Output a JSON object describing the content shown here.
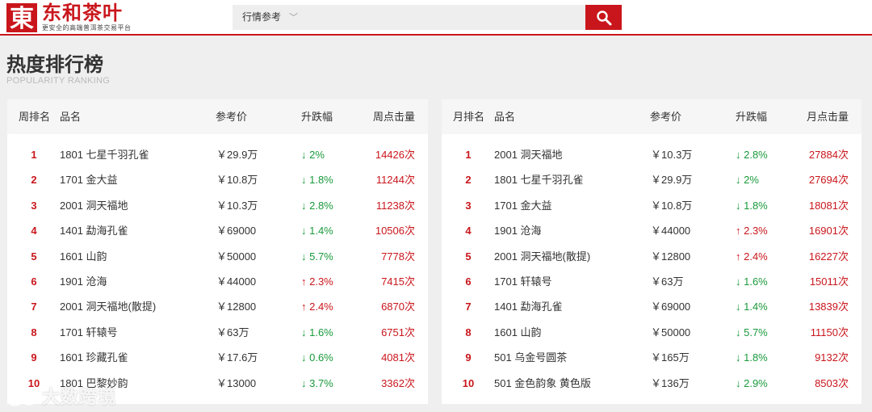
{
  "header": {
    "logo_text": "东和茶叶",
    "logo_mark_char": "東",
    "slogan": "更安全的高端普洱茶交易平台",
    "search_category": "行情参考",
    "search_icon": "search-icon"
  },
  "page": {
    "title": "热度排行榜",
    "subtitle": "POPULARITY RANKING"
  },
  "weekly": {
    "headers": [
      "周排名",
      "品名",
      "参考价",
      "升跌幅",
      "周点击量"
    ],
    "rows": [
      {
        "rank": "1",
        "name": "1801 七星千羽孔雀",
        "price": "￥29.9万",
        "change": "↓ 2%",
        "dir": "down",
        "hits": "14426次"
      },
      {
        "rank": "2",
        "name": "1701 金大益",
        "price": "￥10.8万",
        "change": "↓ 1.8%",
        "dir": "down",
        "hits": "11244次"
      },
      {
        "rank": "3",
        "name": "2001 洞天福地",
        "price": "￥10.3万",
        "change": "↓ 2.8%",
        "dir": "down",
        "hits": "11238次"
      },
      {
        "rank": "4",
        "name": "1401 勐海孔雀",
        "price": "￥69000",
        "change": "↓ 1.4%",
        "dir": "down",
        "hits": "10506次"
      },
      {
        "rank": "5",
        "name": "1601 山韵",
        "price": "￥50000",
        "change": "↓ 5.7%",
        "dir": "down",
        "hits": "7778次"
      },
      {
        "rank": "6",
        "name": "1901 沧海",
        "price": "￥44000",
        "change": "↑ 2.3%",
        "dir": "up",
        "hits": "7415次"
      },
      {
        "rank": "7",
        "name": "2001 洞天福地(散提)",
        "price": "￥12800",
        "change": "↑ 2.4%",
        "dir": "up",
        "hits": "6870次"
      },
      {
        "rank": "8",
        "name": "1701 轩辕号",
        "price": "￥63万",
        "change": "↓ 1.6%",
        "dir": "down",
        "hits": "6751次"
      },
      {
        "rank": "9",
        "name": "1601 珍藏孔雀",
        "price": "￥17.6万",
        "change": "↓ 0.6%",
        "dir": "down",
        "hits": "4081次"
      },
      {
        "rank": "10",
        "name": "1801 巴黎妙韵",
        "price": "￥13000",
        "change": "↓ 3.7%",
        "dir": "down",
        "hits": "3362次"
      }
    ]
  },
  "monthly": {
    "headers": [
      "月排名",
      "品名",
      "参考价",
      "升跌幅",
      "月点击量"
    ],
    "rows": [
      {
        "rank": "1",
        "name": "2001 洞天福地",
        "price": "￥10.3万",
        "change": "↓ 2.8%",
        "dir": "down",
        "hits": "27884次"
      },
      {
        "rank": "2",
        "name": "1801 七星千羽孔雀",
        "price": "￥29.9万",
        "change": "↓ 2%",
        "dir": "down",
        "hits": "27694次"
      },
      {
        "rank": "3",
        "name": "1701 金大益",
        "price": "￥10.8万",
        "change": "↓ 1.8%",
        "dir": "down",
        "hits": "18081次"
      },
      {
        "rank": "4",
        "name": "1901 沧海",
        "price": "￥44000",
        "change": "↑ 2.3%",
        "dir": "up",
        "hits": "16901次"
      },
      {
        "rank": "5",
        "name": "2001 洞天福地(散提)",
        "price": "￥12800",
        "change": "↑ 2.4%",
        "dir": "up",
        "hits": "16227次"
      },
      {
        "rank": "6",
        "name": "1701 轩辕号",
        "price": "￥63万",
        "change": "↓ 1.6%",
        "dir": "down",
        "hits": "15011次"
      },
      {
        "rank": "7",
        "name": "1401 勐海孔雀",
        "price": "￥69000",
        "change": "↓ 1.4%",
        "dir": "down",
        "hits": "13839次"
      },
      {
        "rank": "8",
        "name": "1601 山韵",
        "price": "￥50000",
        "change": "↓ 5.7%",
        "dir": "down",
        "hits": "11150次"
      },
      {
        "rank": "9",
        "name": "501 乌金号圆茶",
        "price": "￥165万",
        "change": "↓ 1.8%",
        "dir": "down",
        "hits": "9132次"
      },
      {
        "rank": "10",
        "name": "501 金色韵象 黄色版",
        "price": "￥136万",
        "change": "↓ 2.9%",
        "dir": "down",
        "hits": "8503次"
      }
    ]
  },
  "watermark": {
    "text": "大数跨境"
  },
  "colors": {
    "brand_red": "#c9161c",
    "down_green": "#1a9a3c",
    "background": "#efefef"
  }
}
